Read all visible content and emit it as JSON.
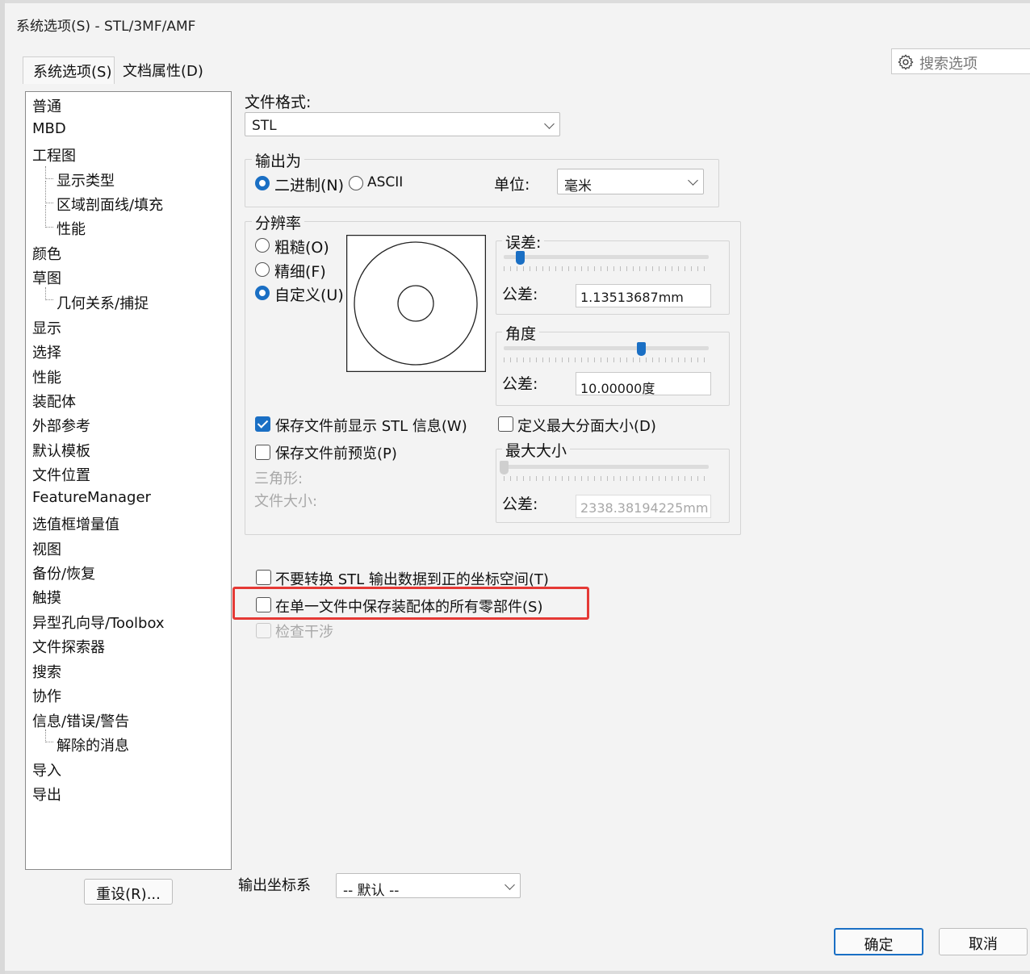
{
  "window": {
    "title": "系统选项(S) - STL/3MF/AMF"
  },
  "search": {
    "label": "搜索选项",
    "icon": "gear-icon"
  },
  "tabs": [
    {
      "label": "系统选项(S)",
      "active": true
    },
    {
      "label": "文档属性(D)",
      "active": false
    }
  ],
  "tree": {
    "items": [
      "普通",
      "MBD",
      "工程图",
      "显示类型",
      "区域剖面线/填充",
      "性能",
      "颜色",
      "草图",
      "几何关系/捕捉",
      "显示",
      "选择",
      "性能",
      "装配体",
      "外部参考",
      "默认模板",
      "文件位置",
      "FeatureManager",
      "选值框增量值",
      "视图",
      "备份/恢复",
      "触摸",
      "异型孔向导/Toolbox",
      "文件探索器",
      "搜索",
      "协作",
      "信息/错误/警告",
      "解除的消息",
      "导入",
      "导出"
    ]
  },
  "reset_button": "重设(R)...",
  "file_format": {
    "label": "文件格式:",
    "value": "STL"
  },
  "output_as": {
    "legend": "输出为",
    "binary": "二进制(N)",
    "ascii": "ASCII",
    "selected": "binary",
    "unit_label": "单位:",
    "unit_value": "毫米"
  },
  "resolution": {
    "legend": "分辨率",
    "coarse": "粗糙(O)",
    "fine": "精细(F)",
    "custom": "自定义(U)",
    "selected": "custom",
    "deviation": {
      "legend": "误差:",
      "tol_label": "公差:",
      "value": "1.13513687mm",
      "slider": 0.08
    },
    "angle": {
      "legend": "角度",
      "tol_label": "公差:",
      "value": "10.00000度",
      "slider": 0.67
    }
  },
  "options": {
    "show_info": {
      "label": "保存文件前显示 STL 信息(W)",
      "checked": true
    },
    "preview": {
      "label": "保存文件前预览(P)",
      "checked": false
    },
    "triangles": "三角形:",
    "file_size": "文件大小:",
    "max_facet": {
      "label": "定义最大分面大小(D)",
      "checked": false
    },
    "max_size": {
      "legend": "最大大小",
      "tol_label": "公差:",
      "value": "2338.38194225mm",
      "slider": 0.0
    },
    "no_transform": {
      "label": "不要转换 STL 输出数据到正的坐标空间(T)",
      "checked": false
    },
    "single_file": {
      "label": "在单一文件中保存装配体的所有零部件(S)",
      "checked": false
    },
    "interference": {
      "label": "检查干涉",
      "checked": false,
      "disabled": true
    }
  },
  "coord_system": {
    "label": "输出坐标系",
    "value": "-- 默认 --"
  },
  "footer": {
    "ok": "确定",
    "cancel": "取消"
  },
  "colors": {
    "accent": "#1a6fc4",
    "highlight": "#e53935"
  }
}
